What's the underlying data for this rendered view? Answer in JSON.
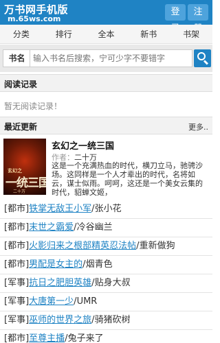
{
  "header": {
    "title": "万书网手机版",
    "domain": "m.65ws.com",
    "login_label": "登录",
    "register_label": "注册",
    "brand_color": "#1f83c4"
  },
  "nav": {
    "items": [
      "分类",
      "排行",
      "全本",
      "新书",
      "书架"
    ]
  },
  "search": {
    "label": "书名",
    "placeholder": "输入书名后搜索，宁可少字不要错字",
    "button_icon": "search-icon"
  },
  "reading_history": {
    "title": "阅读记录",
    "empty_text": "暂无阅读记录！"
  },
  "latest": {
    "title": "最近更新",
    "more_label": "更多..",
    "featured": {
      "cover_text_top": "玄幻之",
      "cover_text_main": "一统三国",
      "cover_text_bottom": "二十万",
      "title": "玄幻之一统三国",
      "author_label": "作者：",
      "author": "二十万",
      "description": "这是一个充满热血的时代，横刀立马，驰骋沙场。这同样是一个人才辈出的时代，名将如云，谋士似雨。呵呵，这还是一个美女云集的时代，貂蝉文姬，"
    },
    "items": [
      {
        "category": "[都市]",
        "title": "铁掌无敌王小军",
        "author": "张小花"
      },
      {
        "category": "[都市]",
        "title": "末世之霸爱",
        "author": "冷谷幽兰"
      },
      {
        "category": "[都市]",
        "title": "火影归来之根部精英忍法帖",
        "author": "重新做狗"
      },
      {
        "category": "[都市]",
        "title": "男配是女主的",
        "author": "烟青色"
      },
      {
        "category": "[军事]",
        "title": "抗日之肥胆英雄",
        "author": "贴身大叔"
      },
      {
        "category": "[军事]",
        "title": "大唐第一少",
        "author": "UMR"
      },
      {
        "category": "[军事]",
        "title": "巫师的世界之旅",
        "author": "骑猪砍树"
      },
      {
        "category": "[都市]",
        "title": "至尊主播",
        "author": "兔子来了"
      }
    ]
  }
}
